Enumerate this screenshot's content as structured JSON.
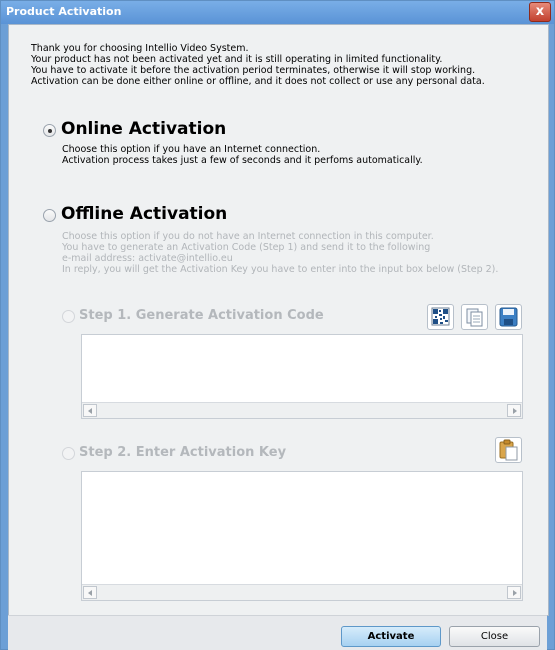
{
  "window": {
    "title": "Product Activation",
    "close_glyph": "x"
  },
  "intro": [
    "Thank you for choosing Intellio Video System.",
    "Your product has not been activated yet and it is still operating in limited functionality.",
    "You have to activate it before the activation period terminates, otherwise it will stop working.",
    "Activation can be done either online or offline, and it does not collect or use any personal data."
  ],
  "online": {
    "label": "Online Activation",
    "selected": true,
    "desc": [
      "Choose this option if you have an Internet connection.",
      "Activation process takes just a few of seconds and it perfoms automatically."
    ]
  },
  "offline": {
    "label": "Offline Activation",
    "selected": false,
    "desc": [
      "Choose this option if you do not have an Internet connection in this computer.",
      "You have to generate an Activation Code (Step 1) and send it to the following",
      "e-mail address: activate@intellio.eu",
      "In reply, you will get the Activation Key you have to enter into the input box below (Step 2)."
    ],
    "step1": {
      "label": "Step 1. Generate Activation Code",
      "value": ""
    },
    "step2": {
      "label": "Step 2. Enter Activation Key",
      "value": ""
    }
  },
  "icons": {
    "qr": "qr-code-icon",
    "copy": "copy-icon",
    "save": "save-icon",
    "paste": "paste-icon"
  },
  "buttons": {
    "activate": "Activate",
    "close": "Close"
  }
}
